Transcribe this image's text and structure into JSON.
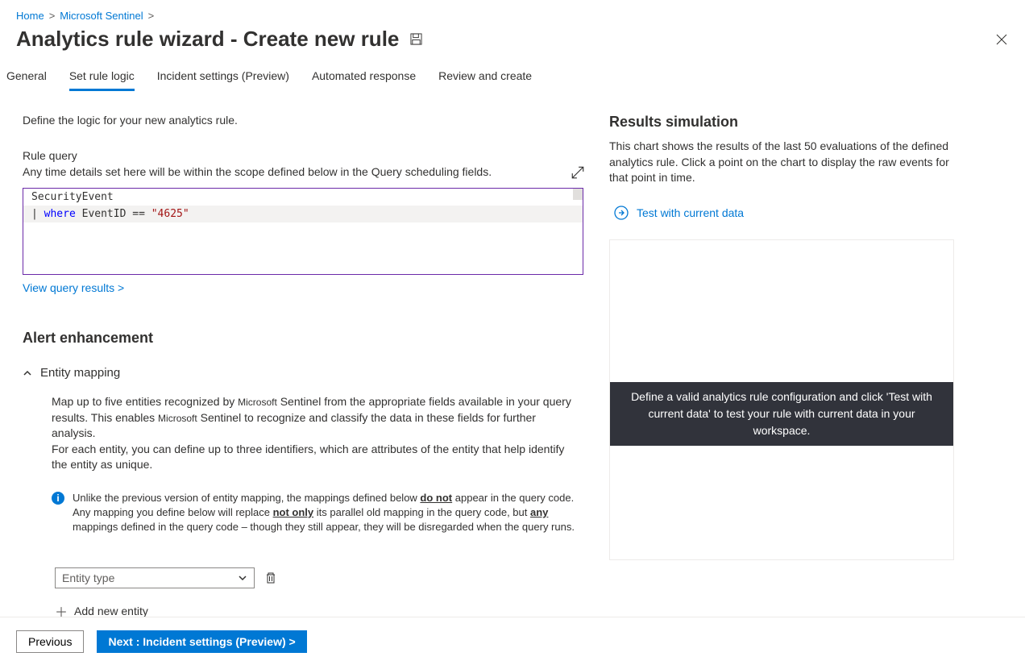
{
  "breadcrumbs": {
    "home": "Home",
    "sentinel": "Microsoft Sentinel"
  },
  "header": {
    "title": "Analytics rule wizard - Create new rule"
  },
  "tabs": {
    "general": "General",
    "set_rule_logic": "Set rule logic",
    "incident_settings": "Incident settings (Preview)",
    "automated_response": "Automated response",
    "review_create": "Review and create"
  },
  "left": {
    "intro": "Define the logic for your new analytics rule.",
    "rule_query_label": "Rule query",
    "rule_query_desc": "Any time details set here will be within the scope defined below in the Query scheduling fields.",
    "query_line1": "SecurityEvent",
    "query_pipe": "| ",
    "query_kw": "where",
    "query_mid": " EventID == ",
    "query_str": "\"4625\"",
    "view_results": "View query results >",
    "alert_enhancement": "Alert enhancement",
    "entity_mapping": "Entity mapping",
    "em_p1a": "Map up to five entities recognized by ",
    "em_p1b": "Microsoft",
    "em_p1c": " Sentinel from the appropriate fields available in your query results. This enables ",
    "em_p1d": "Microsoft",
    "em_p1e": " Sentinel to recognize and classify the data in these fields for further analysis.",
    "em_p2": "For each entity, you can define up to three identifiers, which are attributes of the entity that help identify the entity as unique.",
    "info_a": "Unlike the previous version of entity mapping, the mappings defined below ",
    "info_b": "do not",
    "info_c": " appear in the query code. Any mapping you define below will replace ",
    "info_d": "not only",
    "info_e": " its parallel old mapping in the query code, but ",
    "info_f": "any",
    "info_g": " mappings defined in the query code – though they still appear, they will be disregarded when the query runs.",
    "entity_type_placeholder": "Entity type",
    "add_new_entity": "Add new entity"
  },
  "right": {
    "title": "Results simulation",
    "desc": "This chart shows the results of the last 50 evaluations of the defined analytics rule. Click a point on the chart to display the raw events for that point in time.",
    "test_label": "Test with current data",
    "banner": "Define a valid analytics rule configuration and click 'Test with current data' to test your rule with current data in your workspace."
  },
  "footer": {
    "previous": "Previous",
    "next": "Next : Incident settings (Preview) >"
  }
}
